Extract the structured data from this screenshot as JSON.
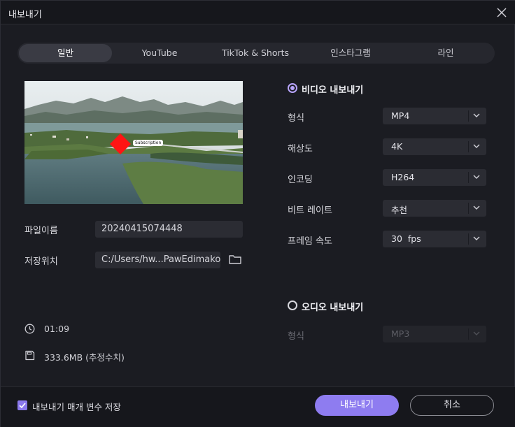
{
  "window": {
    "title": "내보내기"
  },
  "tabs": [
    {
      "label": "일반",
      "active": true
    },
    {
      "label": "YouTube",
      "active": false
    },
    {
      "label": "TikTok & Shorts",
      "active": false
    },
    {
      "label": "인스타그램",
      "active": false
    },
    {
      "label": "라인",
      "active": false
    }
  ],
  "preview": {
    "overlay_text": "Subscription"
  },
  "file": {
    "name_label": "파일이름",
    "name_value": "20240415074448",
    "location_label": "저장위치",
    "location_value": "C:/Users/hw...PawEdimakor"
  },
  "info": {
    "duration": "01:09",
    "size": "333.6MB (추정수치)"
  },
  "video_export": {
    "label": "비디오 내보내기",
    "selected": true,
    "fields": [
      {
        "label": "형식",
        "value": "MP4"
      },
      {
        "label": "해상도",
        "value": "4K"
      },
      {
        "label": "인코딩",
        "value": "H264"
      },
      {
        "label": "비트 레이트",
        "value": "추천"
      },
      {
        "label": "프레임 속도",
        "value": "30  fps"
      }
    ]
  },
  "audio_export": {
    "label": "오디오 내보내기",
    "selected": false,
    "fields": [
      {
        "label": "형식",
        "value": "MP3"
      }
    ]
  },
  "footer": {
    "save_params_label": "내보내기 매개 변수 저장",
    "save_params_checked": true,
    "export_button": "내보내기",
    "cancel_button": "취소"
  },
  "colors": {
    "accent": "#8e7cf0",
    "background": "#1b1c22",
    "field": "#2b2c33"
  }
}
